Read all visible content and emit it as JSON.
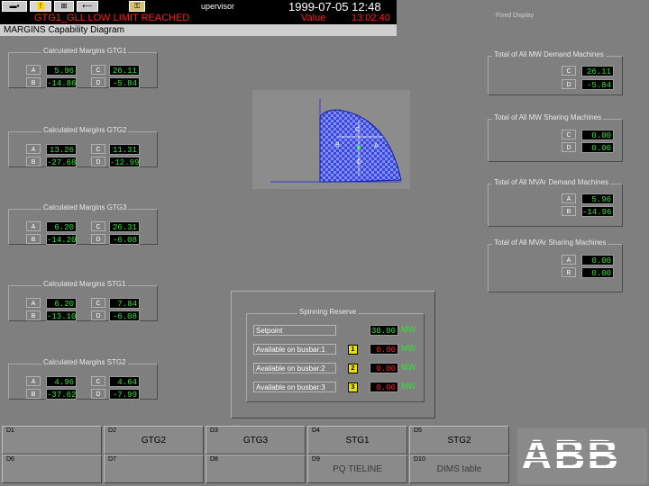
{
  "header": {
    "user": "upervisor",
    "datetime": "1999-07-05  12:48",
    "alarm_text": "GTG1_GLL LOW LIMIT REACHED",
    "alarm_value": "Value",
    "alarm_time": "13:02:40",
    "screen_title": "MARGINS   Capability Diagram",
    "status_right": "Fixed Display",
    "warning_glyph": "!"
  },
  "margins": [
    {
      "title": "Calculated Margins GTG1",
      "a": "5.96",
      "b": "-14.86",
      "c": "26.11",
      "d": "-5.84"
    },
    {
      "title": "Calculated Margins GTG2",
      "a": "13.26",
      "b": "-27.68",
      "c": "11.31",
      "d": "-12.99"
    },
    {
      "title": "Calculated Margins GTG3",
      "a": "6.20",
      "b": "-14.20",
      "c": "26.31",
      "d": "-6.08"
    },
    {
      "title": "Calculated Margins STG1",
      "a": "6.20",
      "b": "-13.10",
      "c": "7.84",
      "d": "-6.08"
    },
    {
      "title": "Calculated Margins STG2",
      "a": "4.96",
      "b": "-37.62",
      "c": "4.64",
      "d": "-7.99"
    }
  ],
  "labels": {
    "a": "A",
    "b": "B",
    "c": "C",
    "d": "D"
  },
  "totals": {
    "mw_demand": {
      "title": "Total of All MW Demand Machines",
      "c": "26.11",
      "d": "-5.84"
    },
    "mw_sharing": {
      "title": "Total of All MW Sharing Machines",
      "c": "0.00",
      "d": "0.00"
    },
    "mvar_demand": {
      "title": "Total of All MVAr Demand Machines",
      "a": "5.96",
      "b": "-14.96"
    },
    "mvar_sharing": {
      "title": "Total of All MVAr Sharing Machines",
      "a": "0.00",
      "b": "0.00"
    }
  },
  "diagram": {
    "c": "C",
    "b": "B",
    "a": "A",
    "d": "D"
  },
  "spinning": {
    "title": "Spinning Reserve",
    "rows": [
      {
        "label": "Setpoint",
        "value": "30.00",
        "unit": "MW",
        "bus": ""
      },
      {
        "label": "Available on busbar:1",
        "value": "0.00",
        "unit": "MW",
        "bus": "1"
      },
      {
        "label": "Available on busbar:2",
        "value": "0.00",
        "unit": "MW",
        "bus": "2"
      },
      {
        "label": "Available on busbar:3",
        "value": "0.00",
        "unit": "MW",
        "bus": "3"
      }
    ]
  },
  "nav": [
    {
      "code": "D1",
      "name": ""
    },
    {
      "code": "D2",
      "name": "GTG2"
    },
    {
      "code": "D3",
      "name": "GTG3"
    },
    {
      "code": "D4",
      "name": "STG1"
    },
    {
      "code": "D5",
      "name": "STG2"
    },
    {
      "code": "D6",
      "name": ""
    },
    {
      "code": "D7",
      "name": ""
    },
    {
      "code": "D8",
      "name": ""
    },
    {
      "code": "D9",
      "name": "PQ TIELINE"
    },
    {
      "code": "D10",
      "name": "DIMS table"
    }
  ],
  "logo": "ABB",
  "colors": {
    "value_green": "#31e631",
    "alarm_red": "#ff2020",
    "diagram_blue": "#2f3fd6"
  }
}
